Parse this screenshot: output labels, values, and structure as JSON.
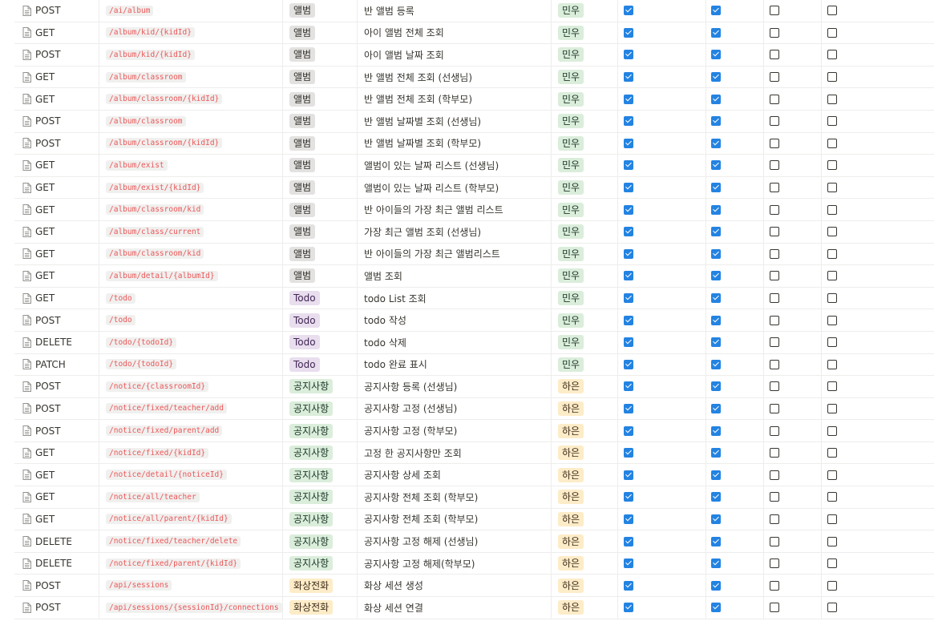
{
  "colors": {
    "tag_album_bg": "#e3e2e0",
    "tag_album_fg": "#32302c",
    "tag_todo_bg": "#e8deee",
    "tag_todo_fg": "#412454",
    "tag_notice_bg": "#dbeddb",
    "tag_notice_fg": "#1c3829",
    "tag_video_bg": "#fdecc8",
    "tag_video_fg": "#402c1b",
    "owner_minu_bg": "#dbeddb",
    "owner_minu_fg": "#1c3829",
    "owner_haeun_bg": "#fdecc8",
    "owner_haeun_fg": "#402c1b",
    "checkbox_checked": "#2383e2"
  },
  "rows": [
    {
      "method": "POST",
      "url": "/ai/album",
      "tag": "앨범",
      "tag_type": "album",
      "desc": "반 앨범 등록",
      "owner": "민우",
      "owner_type": "minu",
      "c1": true,
      "c2": true,
      "c3": false,
      "c4": false
    },
    {
      "method": "GET",
      "url": "/album/kid/{kidId}",
      "tag": "앨범",
      "tag_type": "album",
      "desc": "아이 앨범 전체 조회",
      "owner": "민우",
      "owner_type": "minu",
      "c1": true,
      "c2": true,
      "c3": false,
      "c4": false
    },
    {
      "method": "POST",
      "url": "/album/kid/{kidId}",
      "tag": "앨범",
      "tag_type": "album",
      "desc": "아이 앨범 날짜 조회",
      "owner": "민우",
      "owner_type": "minu",
      "c1": true,
      "c2": true,
      "c3": false,
      "c4": false
    },
    {
      "method": "GET",
      "url": "/album/classroom",
      "tag": "앨범",
      "tag_type": "album",
      "desc": "반 앨범 전체 조회 (선생님)",
      "owner": "민우",
      "owner_type": "minu",
      "c1": true,
      "c2": true,
      "c3": false,
      "c4": false
    },
    {
      "method": "GET",
      "url": "/album/classroom/{kidId}",
      "tag": "앨범",
      "tag_type": "album",
      "desc": "반 앨범 전체 조회 (학부모)",
      "owner": "민우",
      "owner_type": "minu",
      "c1": true,
      "c2": true,
      "c3": false,
      "c4": false
    },
    {
      "method": "POST",
      "url": "/album/classroom",
      "tag": "앨범",
      "tag_type": "album",
      "desc": "반 앨범 날짜별 조회 (선생님)",
      "owner": "민우",
      "owner_type": "minu",
      "c1": true,
      "c2": true,
      "c3": false,
      "c4": false
    },
    {
      "method": "POST",
      "url": "/album/classroom/{kidId}",
      "tag": "앨범",
      "tag_type": "album",
      "desc": "반 앨범 날짜별 조회 (학부모)",
      "owner": "민우",
      "owner_type": "minu",
      "c1": true,
      "c2": true,
      "c3": false,
      "c4": false
    },
    {
      "method": "GET",
      "url": "/album/exist",
      "tag": "앨범",
      "tag_type": "album",
      "desc": "앨범이 있는 날짜 리스트 (선생님)",
      "owner": "민우",
      "owner_type": "minu",
      "c1": true,
      "c2": true,
      "c3": false,
      "c4": false
    },
    {
      "method": "GET",
      "url": "/album/exist/{kidId}",
      "tag": "앨범",
      "tag_type": "album",
      "desc": "앨범이 있는 날짜 리스트 (학부모)",
      "owner": "민우",
      "owner_type": "minu",
      "c1": true,
      "c2": true,
      "c3": false,
      "c4": false
    },
    {
      "method": "GET",
      "url": "/album/classroom/kid",
      "tag": "앨범",
      "tag_type": "album",
      "desc": "반 아이들의 가장 최근 앨범 리스트",
      "owner": "민우",
      "owner_type": "minu",
      "c1": true,
      "c2": true,
      "c3": false,
      "c4": false
    },
    {
      "method": "GET",
      "url": "/album/class/current",
      "tag": "앨범",
      "tag_type": "album",
      "desc": "가장 최근 앨범 조회 (선생님)",
      "owner": "민우",
      "owner_type": "minu",
      "c1": true,
      "c2": true,
      "c3": false,
      "c4": false
    },
    {
      "method": "GET",
      "url": "/album/classroom/kid",
      "tag": "앨범",
      "tag_type": "album",
      "desc": "반 아이들의 가장 최근 앨범리스트",
      "owner": "민우",
      "owner_type": "minu",
      "c1": true,
      "c2": true,
      "c3": false,
      "c4": false
    },
    {
      "method": "GET",
      "url": "/album/detail/{albumId}",
      "tag": "앨범",
      "tag_type": "album",
      "desc": "앨범 조회",
      "owner": "민우",
      "owner_type": "minu",
      "c1": true,
      "c2": true,
      "c3": false,
      "c4": false
    },
    {
      "method": "GET",
      "url": "/todo",
      "tag": "Todo",
      "tag_type": "todo",
      "desc": "todo List 조회",
      "owner": "민우",
      "owner_type": "minu",
      "c1": true,
      "c2": true,
      "c3": false,
      "c4": false
    },
    {
      "method": "POST",
      "url": "/todo",
      "tag": "Todo",
      "tag_type": "todo",
      "desc": "todo 작성",
      "owner": "민우",
      "owner_type": "minu",
      "c1": true,
      "c2": true,
      "c3": false,
      "c4": false
    },
    {
      "method": "DELETE",
      "url": "/todo/{todoId}",
      "tag": "Todo",
      "tag_type": "todo",
      "desc": "todo 삭제",
      "owner": "민우",
      "owner_type": "minu",
      "c1": true,
      "c2": true,
      "c3": false,
      "c4": false
    },
    {
      "method": "PATCH",
      "url": "/todo/{todoId}",
      "tag": "Todo",
      "tag_type": "todo",
      "desc": "todo 완료 표시",
      "owner": "민우",
      "owner_type": "minu",
      "c1": true,
      "c2": true,
      "c3": false,
      "c4": false
    },
    {
      "method": "POST",
      "url": "/notice/{classroomId}",
      "tag": "공지사항",
      "tag_type": "notice",
      "desc": "공지사항 등록 (선생님)",
      "owner": "하은",
      "owner_type": "haeun",
      "c1": true,
      "c2": true,
      "c3": false,
      "c4": false
    },
    {
      "method": "POST",
      "url": "/notice/fixed/teacher/add",
      "tag": "공지사항",
      "tag_type": "notice",
      "desc": "공지사항 고정 (선생님)",
      "owner": "하은",
      "owner_type": "haeun",
      "c1": true,
      "c2": true,
      "c3": false,
      "c4": false
    },
    {
      "method": "POST",
      "url": "/notice/fixed/parent/add",
      "tag": "공지사항",
      "tag_type": "notice",
      "desc": "공지사항 고정 (학부모)",
      "owner": "하은",
      "owner_type": "haeun",
      "c1": true,
      "c2": true,
      "c3": false,
      "c4": false
    },
    {
      "method": "GET",
      "url": "/notice/fixed/{kidId}",
      "tag": "공지사항",
      "tag_type": "notice",
      "desc": "고정 한 공지사항만 조회",
      "owner": "하은",
      "owner_type": "haeun",
      "c1": true,
      "c2": true,
      "c3": false,
      "c4": false
    },
    {
      "method": "GET",
      "url": "/notice/detail/{noticeId}",
      "tag": "공지사항",
      "tag_type": "notice",
      "desc": "공지사항 상세 조회",
      "owner": "하은",
      "owner_type": "haeun",
      "c1": true,
      "c2": true,
      "c3": false,
      "c4": false
    },
    {
      "method": "GET",
      "url": "/notice/all/teacher",
      "tag": "공지사항",
      "tag_type": "notice",
      "desc": "공지사항 전체 조회 (학부모)",
      "owner": "하은",
      "owner_type": "haeun",
      "c1": true,
      "c2": true,
      "c3": false,
      "c4": false
    },
    {
      "method": "GET",
      "url": "/notice/all/parent/{kidId}",
      "tag": "공지사항",
      "tag_type": "notice",
      "desc": "공지사항 전체 조회 (학부모)",
      "owner": "하은",
      "owner_type": "haeun",
      "c1": true,
      "c2": true,
      "c3": false,
      "c4": false
    },
    {
      "method": "DELETE",
      "url": "/notice/fixed/teacher/delete",
      "tag": "공지사항",
      "tag_type": "notice",
      "desc": "공지사항 고정 해제 (선생님)",
      "owner": "하은",
      "owner_type": "haeun",
      "c1": true,
      "c2": true,
      "c3": false,
      "c4": false
    },
    {
      "method": "DELETE",
      "url": "/notice/fixed/parent/{kidId}",
      "tag": "공지사항",
      "tag_type": "notice",
      "desc": "공지사항 고정 해제(학부모)",
      "owner": "하은",
      "owner_type": "haeun",
      "c1": true,
      "c2": true,
      "c3": false,
      "c4": false
    },
    {
      "method": "POST",
      "url": "/api/sessions",
      "tag": "화상전화",
      "tag_type": "video",
      "desc": "화상 세션 생성",
      "owner": "하은",
      "owner_type": "haeun",
      "c1": true,
      "c2": true,
      "c3": false,
      "c4": false
    },
    {
      "method": "POST",
      "url": "/api/sessions/{sessionId}/connections",
      "tag": "화상전화",
      "tag_type": "video",
      "desc": "화상 세션 연결",
      "owner": "하은",
      "owner_type": "haeun",
      "c1": true,
      "c2": true,
      "c3": false,
      "c4": false
    }
  ]
}
